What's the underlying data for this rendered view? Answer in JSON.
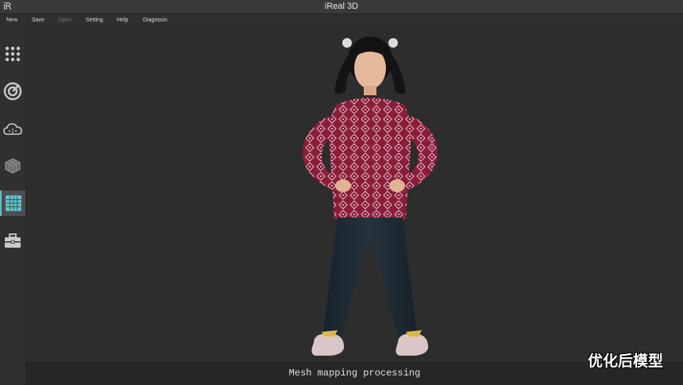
{
  "app": {
    "logo_text": "iR",
    "title": "iReal 3D"
  },
  "menu": {
    "items": [
      {
        "label": "New",
        "enabled": true
      },
      {
        "label": "Save",
        "enabled": true
      },
      {
        "label": "Open",
        "enabled": false
      },
      {
        "label": "Setting",
        "enabled": true
      },
      {
        "label": "Help",
        "enabled": true
      },
      {
        "label": "Diagnosis",
        "enabled": true
      }
    ]
  },
  "sidebar": {
    "tools": [
      {
        "icon": "grid-dots-icon",
        "active": false
      },
      {
        "icon": "target-icon",
        "active": false
      },
      {
        "icon": "cloud-icon",
        "active": false
      },
      {
        "icon": "mesh-cube-icon",
        "active": false
      },
      {
        "icon": "texture-grid-icon",
        "active": true
      },
      {
        "icon": "toolbox-icon",
        "active": false
      }
    ]
  },
  "status": {
    "message": "Mesh mapping processing"
  },
  "watermark": {
    "text": "优化后模型"
  },
  "colors": {
    "accent": "#5fbfc7",
    "sweater": "#8a1e3a",
    "jeans": "#1e2b33"
  }
}
